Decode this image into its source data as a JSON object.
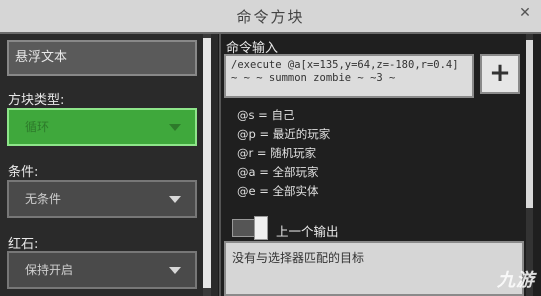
{
  "window": {
    "title": "命令方块"
  },
  "left_panel": {
    "hover_text": "悬浮文本",
    "block_type_label": "方块类型:",
    "block_type_value": "循环",
    "condition_label": "条件:",
    "condition_value": "无条件",
    "redstone_label": "红石:",
    "redstone_value": "保持开启"
  },
  "right_panel": {
    "command_input_label": "命令输入",
    "command_text": "/execute @a[x=135,y=64,z=-180,r=0.4] ~ ~ ~ summon zombie ~ ~3 ~",
    "add_button_label": "+",
    "selectors": [
      "@s = 自己",
      "@p = 最近的玩家",
      "@r = 随机玩家",
      "@a = 全部玩家",
      "@e = 全部实体"
    ],
    "previous_output_label": "上一个输出",
    "output_text": "没有与选择器匹配的目标"
  },
  "watermark": "九游"
}
